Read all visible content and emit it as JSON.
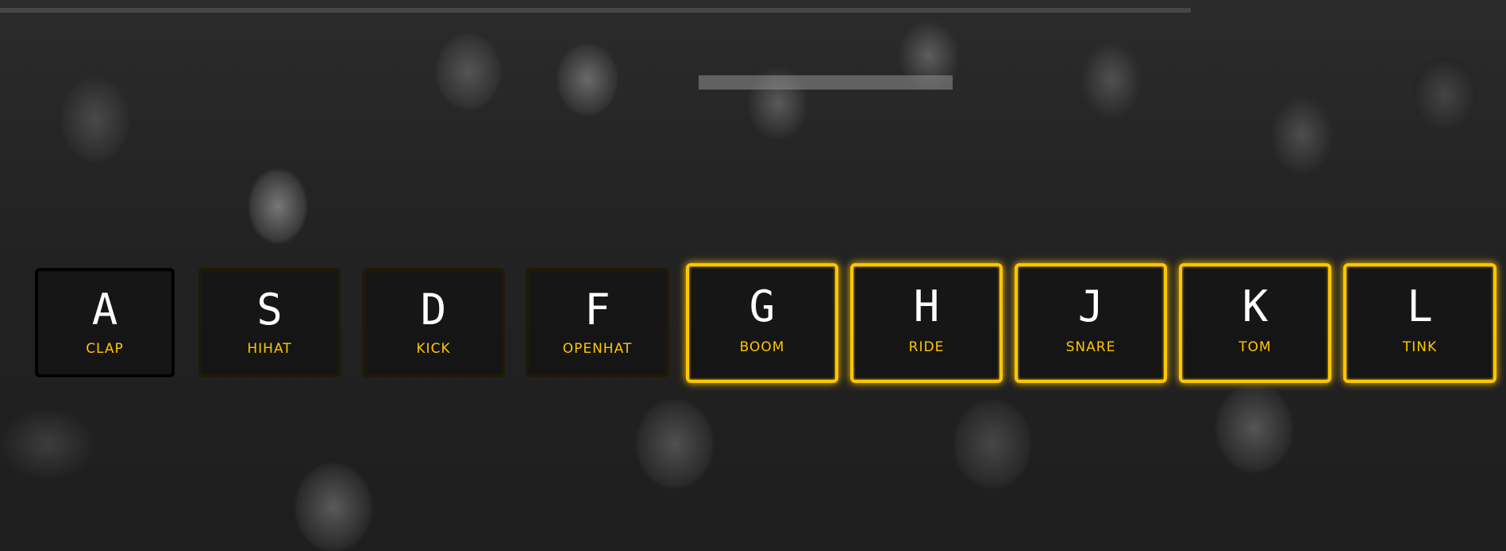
{
  "keys": [
    {
      "letter": "A",
      "sound": "CLAP"
    },
    {
      "letter": "S",
      "sound": "HIHAT"
    },
    {
      "letter": "D",
      "sound": "KICK"
    },
    {
      "letter": "F",
      "sound": "OPENHAT"
    },
    {
      "letter": "G",
      "sound": "BOOM"
    },
    {
      "letter": "H",
      "sound": "RIDE"
    },
    {
      "letter": "J",
      "sound": "SNARE"
    },
    {
      "letter": "K",
      "sound": "TOM"
    },
    {
      "letter": "L",
      "sound": "TINK"
    }
  ],
  "colors": {
    "accent": "#ffc600",
    "background": "#222222",
    "text": "#ffffff"
  }
}
